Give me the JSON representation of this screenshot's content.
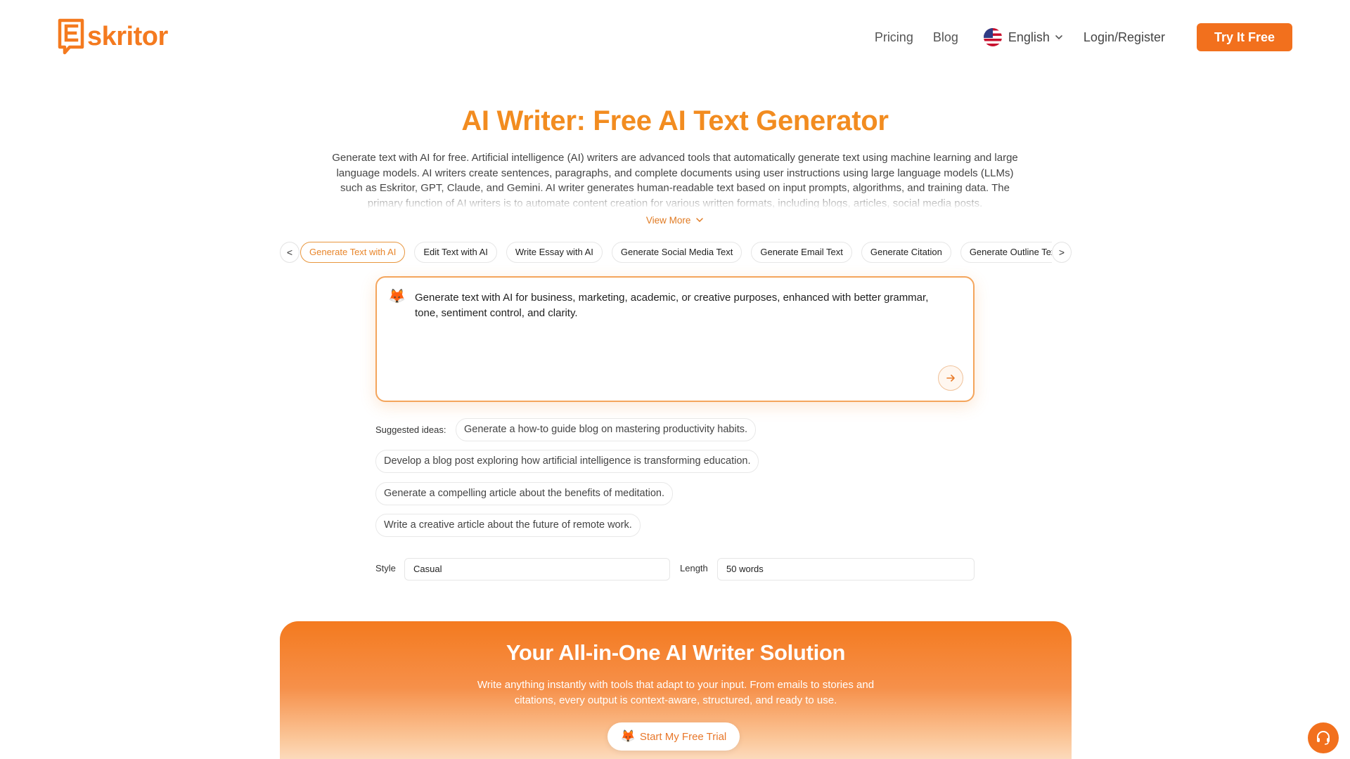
{
  "brand": {
    "name_tail": "skritor",
    "accent": "#f2701d"
  },
  "nav": {
    "pricing": "Pricing",
    "blog": "Blog",
    "language": "English",
    "login": "Login/Register",
    "cta": "Try It Free"
  },
  "hero": {
    "title": "AI Writer: Free AI Text Generator",
    "description": "Generate text with AI for free. Artificial intelligence (AI) writers are advanced tools that automatically generate text using machine learning and large language models. AI writers create sentences, paragraphs, and complete documents using user instructions using large language models (LLMs) such as Eskritor, GPT, Claude, and Gemini. AI writer generates human-readable text based on input prompts, algorithms, and training data. The primary function of AI writers is to automate content creation for various written formats, including blogs, articles, social media posts.",
    "view_more": "View More"
  },
  "tabs": {
    "prev": "<",
    "next": ">",
    "items": [
      "Generate Text with AI",
      "Edit Text with AI",
      "Write Essay with AI",
      "Generate Social Media Text",
      "Generate Email Text",
      "Generate Citation",
      "Generate Outline Text"
    ]
  },
  "prompt": {
    "text": "Generate text with AI for business, marketing, academic, or creative purposes, enhanced with better grammar, tone, sentiment control, and clarity."
  },
  "suggestions": {
    "label": "Suggested ideas:",
    "items": [
      "Generate a how-to guide blog on mastering productivity habits.",
      "Develop a blog post exploring how artificial intelligence is transforming education.",
      "Generate a compelling article about the benefits of meditation.",
      "Write a creative article about the future of remote work."
    ]
  },
  "options": {
    "style_label": "Style",
    "style_value": "Casual",
    "length_label": "Length",
    "length_value": "50 words"
  },
  "promo": {
    "title": "Your All-in-One AI Writer Solution",
    "description": "Write anything instantly with tools that adapt to your input. From emails to stories and citations, every output is context-aware, structured, and ready to use.",
    "button": "Start My Free Trial"
  },
  "icons": [
    "eskritor-logo",
    "us-flag-icon",
    "chevron-down-icon",
    "fox-icon",
    "arrow-right-icon",
    "support-chat-icon"
  ]
}
